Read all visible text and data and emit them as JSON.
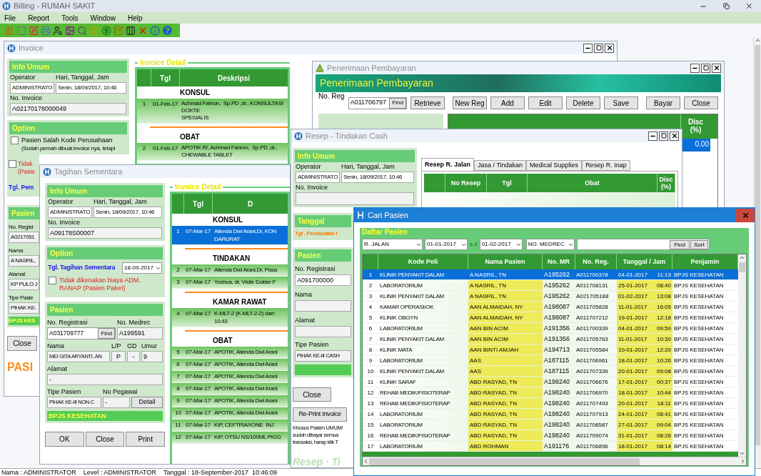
{
  "app": {
    "title": "Billing - RUMAH SAKIT",
    "menu": [
      "File",
      "Report",
      "Tools",
      "Window",
      "Help"
    ]
  },
  "invoice": {
    "title": "Invoice",
    "info": {
      "header": "Info Umum",
      "operator_label": "Operator",
      "datetime_label": "Hari, Tanggal, Jam",
      "operator": "ADMINISTRATO",
      "datetime": "Senin, 18/09/2017, 10:46",
      "invoice_label": "No. Invoice",
      "invoice_no": "A02170178000049"
    },
    "option": {
      "header": "Option",
      "checks": [
        {
          "label": "Pasien Salah Kode Perusahaan",
          "note": "(Sudah pernah dibuat invoice nya, tetapi",
          "checked": false
        },
        {
          "label": "Tidak",
          "note": "(Pasie",
          "checked": false
        }
      ],
      "date_label": "Tgl. Pem"
    },
    "pasien": {
      "header": "Pasien",
      "fields": [
        {
          "label": "No. Regist",
          "value": "A0217051"
        },
        {
          "label": "Nama",
          "value": "A NASRIL,"
        },
        {
          "label": "Alamat",
          "value": "KP PULO J"
        },
        {
          "label": "Tipe Pasie",
          "value": "PIHAK KE-"
        }
      ],
      "payer": "BPJS KES"
    },
    "close": "Close",
    "banner": "PASI",
    "detail": {
      "title": "Invoice Detail",
      "columns": [
        "Tgl",
        "Deskripsi"
      ],
      "groups": [
        {
          "name": "KONSUL",
          "rows": [
            {
              "no": "1",
              "tgl": "01-Feb-17",
              "desc": "Achmad Fahron,  Sp.PD ,dr., KONSULTASI DOKTE\nSPESIALIS",
              "selected": false
            }
          ]
        },
        {
          "name": "OBAT",
          "rows": [
            {
              "no": "2",
              "tgl": "01-Feb-17",
              "desc": "APOTIK R/, Achmad Fahron,  Sp.PD ,dr.,\nCHEWABLE TABLET",
              "selected": false
            }
          ]
        }
      ]
    }
  },
  "tagihan": {
    "title": "Tagihan Sementara",
    "info": {
      "header": "Info Umum",
      "operator_label": "Operator",
      "datetime_label": "Hari, Tanggal, Jam",
      "operator": "ADMINISTRATO",
      "datetime": "Senin, 18/09/2017, 10:46",
      "invoice_label": "No. Invoice",
      "invoice_no": "A09178S00007"
    },
    "option": {
      "header": "Option",
      "date_label": "Tgl. Tagihan Sementara",
      "date": "18-09-2017",
      "check": {
        "label": "Tidak dikenakan biaya ADM. RANAP (Pasien Paket)",
        "checked": false
      }
    },
    "pasien": {
      "header": "Pasien",
      "reg_label": "No. Registrasi",
      "reg": "A031709777",
      "find": "Find",
      "medrec_label": "No. Medrec",
      "medrec": "A199591",
      "nama_label": "Nama",
      "nama": "MEI GITA ARYANTI, AN",
      "lp_label": "L/P",
      "lp": "P",
      "gd_label": "GD",
      "gd": "-",
      "umur_label": "Umur",
      "umur": "9",
      "alamat_label": "Alamat",
      "alamat": "-",
      "tipe_label": "Tipe Pasien",
      "tipe": "PIHAK KE-III NON C",
      "pegawai_label": "No Pegawai",
      "pegawai": "-",
      "detail": "Detail",
      "payer": "BPJS KESEHATAN"
    },
    "buttons": [
      "OK",
      "Close",
      "Print"
    ],
    "detail": {
      "title": "Invoice Detail",
      "columns": [
        "Tgl",
        "D"
      ],
      "groups": [
        {
          "name": "KONSUL",
          "rows": [
            {
              "no": "1",
              "tgl": "07-Mar-17",
              "desc": "Alienda Dwi Arani,Dr, KON\nDARURAT",
              "selected": true
            }
          ]
        },
        {
          "name": "TINDAKAN",
          "rows": [
            {
              "no": "2",
              "tgl": "07-Mar-17",
              "desc": "Alienda Dwi Arani,Dr, Pasa",
              "selected": false
            },
            {
              "no": "3",
              "tgl": "07-Mar-17",
              "desc": "Yoshua, dr, Visite Dokter F",
              "selected": false
            }
          ]
        },
        {
          "name": "KAMAR RAWAT",
          "rows": [
            {
              "no": "4",
              "tgl": "07-Mar-17",
              "desc": "K-MLT-2 (K-MLT-2-2) dari:\n10:43",
              "selected": false
            }
          ]
        },
        {
          "name": "OBAT",
          "rows": [
            {
              "no": "5",
              "tgl": "07-Mar-17",
              "desc": "APOTIK, Alienda Dwi Arani",
              "selected": false
            },
            {
              "no": "6",
              "tgl": "07-Mar-17",
              "desc": "APOTIK, Alienda Dwi Arani",
              "selected": false
            },
            {
              "no": "7",
              "tgl": "07-Mar-17",
              "desc": "APOTIK, Alienda Dwi Arani",
              "selected": false
            },
            {
              "no": "8",
              "tgl": "07-Mar-17",
              "desc": "APOTIK, Alienda Dwi Arani",
              "selected": false
            },
            {
              "no": "9",
              "tgl": "07-Mar-17",
              "desc": "APOTIK, Alienda Dwi Arani",
              "selected": false
            },
            {
              "no": "10",
              "tgl": "07-Mar-17",
              "desc": "APOTIK, Alienda Dwi Arani",
              "selected": false
            },
            {
              "no": "11",
              "tgl": "07-Mar-17",
              "desc": "KIP, CEFTRIAXONE  INJ",
              "selected": false
            },
            {
              "no": "12",
              "tgl": "07-Mar-17",
              "desc": "KIP, OTSU NS/100ML PIGG",
              "selected": false
            }
          ]
        }
      ]
    }
  },
  "penerimaan": {
    "title": "Penerimaan Pembayaran",
    "banner": "Penerimaan Pembayaran",
    "reg_label": "No. Reg",
    "reg": "A011706797",
    "find": "Find",
    "buttons": [
      "Retrieve",
      "New Reg",
      "Add",
      "Edit",
      "Delete",
      "Save",
      "Bayar",
      "Close"
    ],
    "disc_header": "Disc\n(%)",
    "disc_value": "0.00",
    "disc_selected": true
  },
  "resep": {
    "title": "Resep - Tindakan Cash",
    "info": {
      "header": "Info Umum",
      "operator_label": "Operator",
      "datetime_label": "Hari, Tanggal, Jam",
      "operator": "ADMINISTRATO",
      "datetime": "Senin, 18/09/2017, 10:46",
      "invoice_label": "No. Invoice"
    },
    "tabs": [
      {
        "label": "Resep R. Jalan",
        "selected": true
      },
      {
        "label": "Jasa / Tindakan",
        "selected": false
      },
      {
        "label": "Medical Supplies",
        "selected": false
      },
      {
        "label": "Resep R. Inap",
        "selected": false
      }
    ],
    "columns": [
      "No Resep",
      "Tgl",
      "Obat",
      "Disc\n(%)"
    ],
    "tanggal": {
      "header": "Tanggal",
      "label": "Tgl . Pembuatan I"
    },
    "pasien": {
      "header": "Pasien",
      "reg_label": "No. Registrasi",
      "reg": "A091700000",
      "nama_label": "Nama",
      "alamat_label": "Alamat",
      "tipe_label": "Tipe Pasien",
      "tipe": "PIHAK KE-III CASH"
    },
    "close": "Close",
    "reprint": "Re-Print Invoice",
    "note": [
      "Khusus Pasien UMUM/",
      "sudah dibayar semua",
      "transaksi, harap klik T"
    ],
    "watermark": "Resep · Ti"
  },
  "cari_pasien": {
    "title": "Cari Pasien",
    "group": "Daftar Pasien",
    "filters": {
      "unit": "R. JALAN",
      "from": "01-01-2017",
      "sd": "s.d",
      "to": "01-02-2017",
      "key": "NO. MEDREC",
      "find": "Find",
      "sort": "Sort"
    },
    "columns": [
      "Kode Poli",
      "Nama Pasien",
      "No. MR",
      "No. Reg.",
      "Tanggal / Jam",
      "Penjamin"
    ],
    "rows": [
      {
        "no": "1",
        "poli": "KLINIK PENYAKIT DALAM",
        "nama": "A NASRIL, TN",
        "mr": "A195262",
        "reg": "A011700378",
        "date": "04-01-2017",
        "time": "11:13",
        "penjamin": "BPJS KESEHATAN",
        "selected": true
      },
      {
        "no": "2",
        "poli": "LABORATORIUM",
        "nama": "A NASRIL, TN",
        "mr": "A195262",
        "reg": "A011708131",
        "date": "25-01-2017",
        "time": "08:40",
        "penjamin": "BPJS KESEHATAN",
        "selected": false
      },
      {
        "no": "3",
        "poli": "KLINIK PENYAKIT DALAM",
        "nama": "A NASRIL, TN",
        "mr": "A195262",
        "reg": "A021705188",
        "date": "01-02-2017",
        "time": "13:08",
        "penjamin": "BPJS KESEHATAN",
        "selected": false
      },
      {
        "no": "4",
        "poli": "KAMAR OPERASI/OK",
        "nama": "AAN ALMAIDAH, NY",
        "mr": "A198087",
        "reg": "A011705828",
        "date": "11-01-2017",
        "time": "16:05",
        "penjamin": "BPJS KESEHATAN",
        "selected": false
      },
      {
        "no": "5",
        "poli": "KLINIK OBGYN",
        "nama": "AAN ALMAIDAH, NY",
        "mr": "A198087",
        "reg": "A011707212",
        "date": "19-01-2017",
        "time": "12:18",
        "penjamin": "BPJS KESEHATAN",
        "selected": false
      },
      {
        "no": "6",
        "poli": "LABORATORIUM",
        "nama": "AAN BIN ACIM",
        "mr": "A191356",
        "reg": "A011700339",
        "date": "04-01-2017",
        "time": "09:59",
        "penjamin": "BPJS KESEHATAN",
        "selected": false
      },
      {
        "no": "7",
        "poli": "KLINIK PENYAKIT DALAM",
        "nama": "AAN BIN ACIM",
        "mr": "A191356",
        "reg": "A011705763",
        "date": "11-01-2017",
        "time": "10:30",
        "penjamin": "BPJS KESEHATAN",
        "selected": false
      },
      {
        "no": "8",
        "poli": "KLINIK MATA",
        "nama": "AAN BINTI AMJAH",
        "mr": "A194713",
        "reg": "A011705584",
        "date": "10-01-2017",
        "time": "12:20",
        "penjamin": "BPJS KESEHATAN",
        "selected": false
      },
      {
        "no": "9",
        "poli": "LABORATORIUM",
        "nama": "AAS",
        "mr": "A187115",
        "reg": "A011706961",
        "date": "18-01-2017",
        "time": "10:26",
        "penjamin": "BPJS KESEHATAN",
        "selected": false
      },
      {
        "no": "10",
        "poli": "KLINIK PENYAKIT DALAM",
        "nama": "AAS",
        "mr": "A187115",
        "reg": "A011707339",
        "date": "20-01-2017",
        "time": "09:08",
        "penjamin": "BPJS KESEHATAN",
        "selected": false
      },
      {
        "no": "11",
        "poli": "KLINIK SARAF",
        "nama": "ABD RASYAD, TN",
        "mr": "A198240",
        "reg": "A011706676",
        "date": "17-01-2017",
        "time": "00:37",
        "penjamin": "BPJS KESEHATAN",
        "selected": false
      },
      {
        "no": "12",
        "poli": "REHAB MEDIK/FISIOTERAP",
        "nama": "ABD RASYAD, TN",
        "mr": "A198240",
        "reg": "A011706970",
        "date": "18-01-2017",
        "time": "10:44",
        "penjamin": "BPJS KESEHATAN",
        "selected": false
      },
      {
        "no": "13",
        "poli": "REHAB MEDIK/FISIOTERAP",
        "nama": "ABD RASYAD, TN",
        "mr": "A198240",
        "reg": "A011707493",
        "date": "20-01-2017",
        "time": "18:11",
        "penjamin": "BPJS KESEHATAN",
        "selected": false
      },
      {
        "no": "14",
        "poli": "LABORATORIUM",
        "nama": "ABD RASYAD, TN",
        "mr": "A198240",
        "reg": "A011707913",
        "date": "24-01-2017",
        "time": "08:41",
        "penjamin": "BPJS KESEHATAN",
        "selected": false
      },
      {
        "no": "15",
        "poli": "LABORATORIUM",
        "nama": "ABD RASYAD, TN",
        "mr": "A198240",
        "reg": "A011708587",
        "date": "27-01-2017",
        "time": "09:04",
        "penjamin": "BPJS KESEHATAN",
        "selected": false
      },
      {
        "no": "16",
        "poli": "REHAB MEDIK/FISIOTERAP",
        "nama": "ABD RASYAD, TN",
        "mr": "A198240",
        "reg": "A011709074",
        "date": "31-01-2017",
        "time": "08:26",
        "penjamin": "BPJS KESEHATAN",
        "selected": false
      },
      {
        "no": "17",
        "poli": "LABORATORIUM",
        "nama": "ABD ROHMAN",
        "mr": "A191176",
        "reg": "A011706896",
        "date": "18-01-2017",
        "time": "08:14",
        "penjamin": "BPJS KESEHATAN",
        "selected": false
      }
    ]
  },
  "status_bar": [
    "Nama : ADMINISTRATOR",
    "Level : ADMINISTRATOR",
    "Tanggal : 18-September-2017  10:46:09"
  ]
}
